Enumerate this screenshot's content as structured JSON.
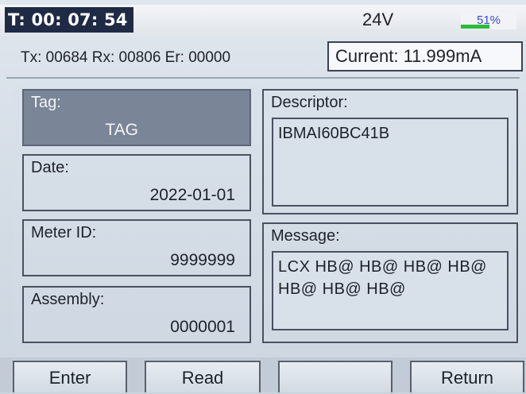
{
  "status": {
    "timer": "T: 00: 07: 54",
    "voltage": "24V",
    "battery": {
      "text": "51%",
      "level": 0.51,
      "color": "#2dbb3c"
    }
  },
  "counters": {
    "text": "Tx: 00684 Rx: 00806 Er: 00000",
    "current": "Current: 11.999mA"
  },
  "fields": {
    "tag": {
      "label": "Tag:",
      "value": "TAG"
    },
    "date": {
      "label": "Date:",
      "value": "2022-01-01"
    },
    "meter_id": {
      "label": "Meter ID:",
      "value": "9999999"
    },
    "assembly": {
      "label": "Assembly:",
      "value": "0000001"
    },
    "descriptor": {
      "label": "Descriptor:",
      "value": "IBMAI60BC41B"
    },
    "message": {
      "label": "Message:",
      "value": "LCX HB@ HB@ HB@ HB@ HB@ HB@ HB@"
    }
  },
  "softkeys": {
    "enter": "Enter",
    "read": "Read",
    "blank": "",
    "return": "Return"
  },
  "colors": {
    "timer_bg": "#1f2a45",
    "selected_field": "#7a8597",
    "battery_fill": "#2dbb3c"
  }
}
